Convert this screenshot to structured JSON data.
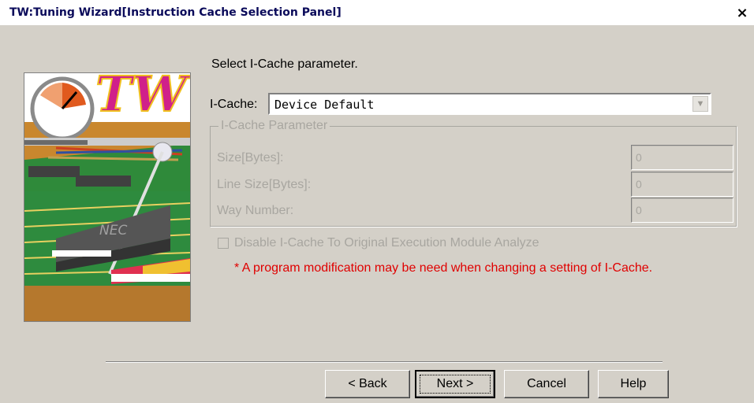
{
  "window": {
    "title": "TW:Tuning Wizard[Instruction Cache Selection Panel]",
    "close_glyph": "×"
  },
  "panel": {
    "heading": "Select I-Cache parameter.",
    "icache_label": "I-Cache:",
    "icache_value": "Device Default",
    "group_title": "I-Cache Parameter",
    "fields": [
      {
        "label": "Size[Bytes]:",
        "value": "0"
      },
      {
        "label": "Line Size[Bytes]:",
        "value": "0"
      },
      {
        "label": "Way Number:",
        "value": "0"
      }
    ],
    "checkbox_label": "Disable I-Cache To Original Execution Module Analyze",
    "checkbox_checked": false,
    "warning": "* A program modification may be need when changing a setting of I-Cache.",
    "wizard_image_text": "TW",
    "chip_text": "NEC"
  },
  "buttons": {
    "back": "< Back",
    "next": "Next >",
    "cancel": "Cancel",
    "help": "Help"
  }
}
